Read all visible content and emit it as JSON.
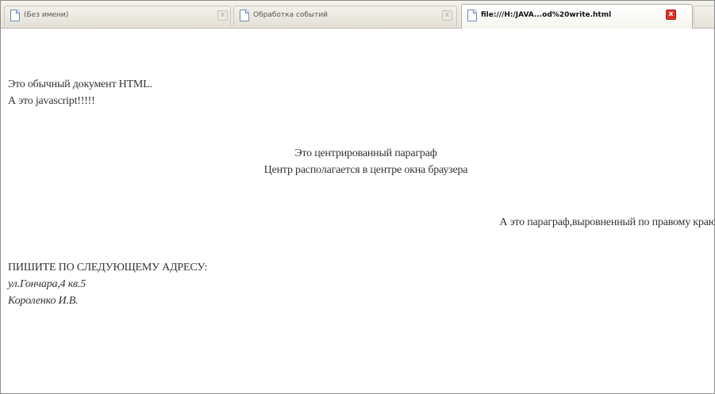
{
  "tabs": [
    {
      "title": "(Без имени)",
      "active": false,
      "icon": "page-icon"
    },
    {
      "title": "Обработка событий",
      "active": false,
      "icon": "page-icon"
    },
    {
      "title": "file:///H:/JAVA...od%20write.html",
      "active": true,
      "icon": "page-icon"
    }
  ],
  "close_glyph": "x",
  "colors": {
    "text": "#333333",
    "active_close": "#d9342b",
    "tab_strip": "#e7e4db"
  },
  "document": {
    "line1": "Это обычный документ HTML.",
    "line2": "А это javascript!!!!!",
    "centered1": "Это центрированный параграф",
    "centered2": "Центр располагается в центре окна браузера",
    "right_aligned": "А это параграф,выровненный по правому краю",
    "address_heading": "ПИШИТЕ ПО СЛЕДУЮЩЕМУ АДРЕСУ:",
    "address_street": "ул.Гончара,4 кв.5",
    "address_name": "Короленко И.В."
  }
}
